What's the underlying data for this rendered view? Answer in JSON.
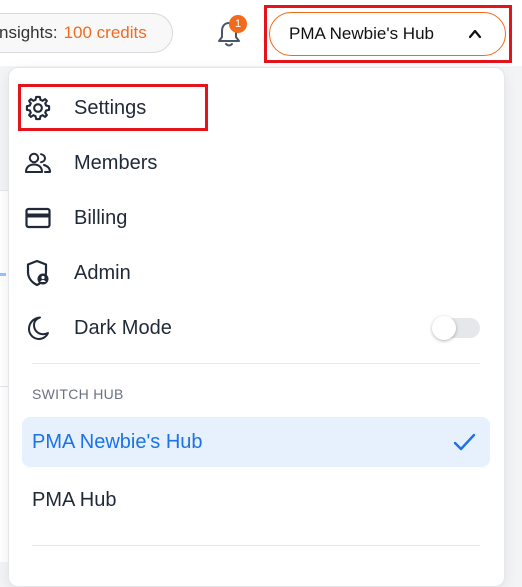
{
  "topbar": {
    "credits_label": "nsights:",
    "credits_value": "100 credits",
    "notification_count": "1",
    "hub_button_label": "PMA Newbie's Hub"
  },
  "menu": {
    "items": [
      {
        "label": "Settings",
        "icon": "gear-icon"
      },
      {
        "label": "Members",
        "icon": "members-icon"
      },
      {
        "label": "Billing",
        "icon": "credit-card-icon"
      },
      {
        "label": "Admin",
        "icon": "shield-user-icon"
      },
      {
        "label": "Dark Mode",
        "icon": "moon-icon"
      }
    ],
    "dark_mode_enabled": false,
    "switch_hub_label": "SWITCH HUB",
    "hubs": [
      {
        "name": "PMA Newbie's Hub",
        "selected": true
      },
      {
        "name": "PMA Hub",
        "selected": false
      }
    ]
  },
  "colors": {
    "accent": "#f26b1d",
    "selected_hub_text": "#1a73e8",
    "selected_hub_bg": "#e7f0fd",
    "highlight_box": "#e3141a"
  }
}
